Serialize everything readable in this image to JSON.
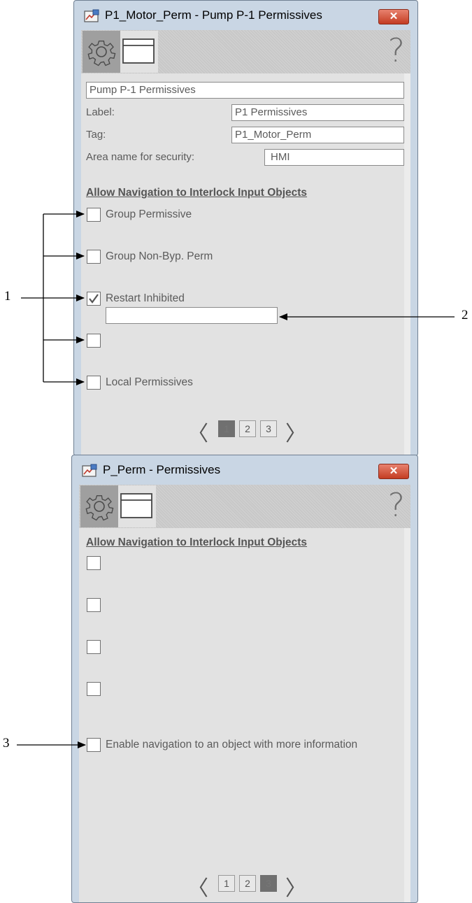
{
  "window1": {
    "title": "P1_Motor_Perm - Pump P-1 Permissives",
    "description_value": "Pump P-1 Permissives",
    "label_caption": "Label:",
    "label_value": "P1 Permissives",
    "tag_caption": "Tag:",
    "tag_value": "P1_Motor_Perm",
    "area_caption": "Area name for security:",
    "area_value": "HMI",
    "section_title": "Allow Navigation to Interlock Input Objects",
    "checkboxes": [
      {
        "label": "Group Permissive",
        "checked": false
      },
      {
        "label": "Group Non-Byp. Perm",
        "checked": false
      },
      {
        "label": "Restart Inhibited",
        "checked": true
      },
      {
        "label": "",
        "checked": false
      },
      {
        "label": "Local Permissives",
        "checked": false
      }
    ],
    "restart_inhibited_object": "",
    "pager": {
      "prev": "〈",
      "next": "〉",
      "pages": [
        "1",
        "2",
        "3"
      ],
      "current": "1"
    }
  },
  "window2": {
    "title": "P_Perm - Permissives",
    "section_title": "Allow Navigation to Interlock Input Objects",
    "checkboxes": [
      {
        "label": "",
        "checked": false
      },
      {
        "label": "",
        "checked": false
      },
      {
        "label": "",
        "checked": false
      },
      {
        "label": "",
        "checked": false
      },
      {
        "label": "Enable navigation to an object with more information",
        "checked": false
      }
    ],
    "pager": {
      "prev": "〈",
      "next": "〉",
      "pages": [
        "1",
        "2",
        "3"
      ],
      "current": "3"
    }
  },
  "callouts": [
    "1",
    "2",
    "3"
  ],
  "icons": {
    "app": "faceplate-app-icon",
    "close": "close-icon",
    "settings": "gear-icon",
    "display": "window-icon",
    "help": "help-icon",
    "check": "checkmark-icon"
  },
  "colors": {
    "close_button": "#c43c22",
    "frame": "#c9d6e4",
    "client": "#e2e2e2",
    "active_page": "#707070"
  },
  "close_glyph": "✕",
  "help_glyph": "?"
}
